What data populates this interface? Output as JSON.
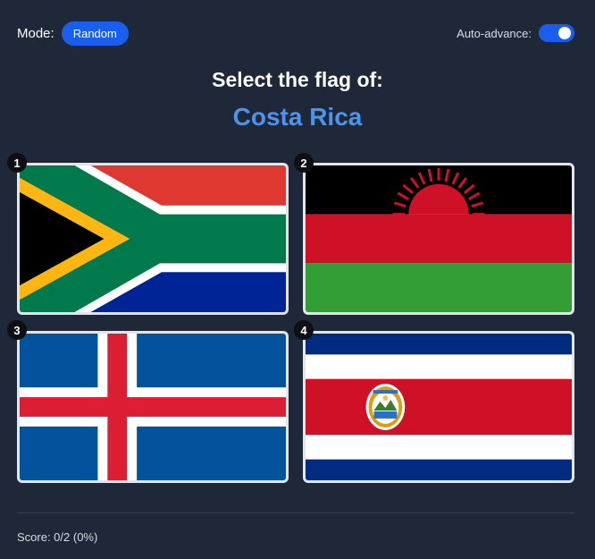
{
  "header": {
    "mode_label": "Mode:",
    "mode_value": "Random",
    "auto_advance_label": "Auto-advance:",
    "auto_advance_on": true
  },
  "question": {
    "prompt": "Select the flag of:",
    "country": "Costa Rica"
  },
  "options": [
    {
      "number": "1",
      "flag": "south-africa-flag"
    },
    {
      "number": "2",
      "flag": "malawi-flag"
    },
    {
      "number": "3",
      "flag": "iceland-flag"
    },
    {
      "number": "4",
      "flag": "costa-rica-flag"
    }
  ],
  "footer": {
    "score_text": "Score: 0/2 (0%)"
  },
  "colors": {
    "background": "#1f2838",
    "accent": "#1a5ef0",
    "target_text": "#4b94ef"
  }
}
